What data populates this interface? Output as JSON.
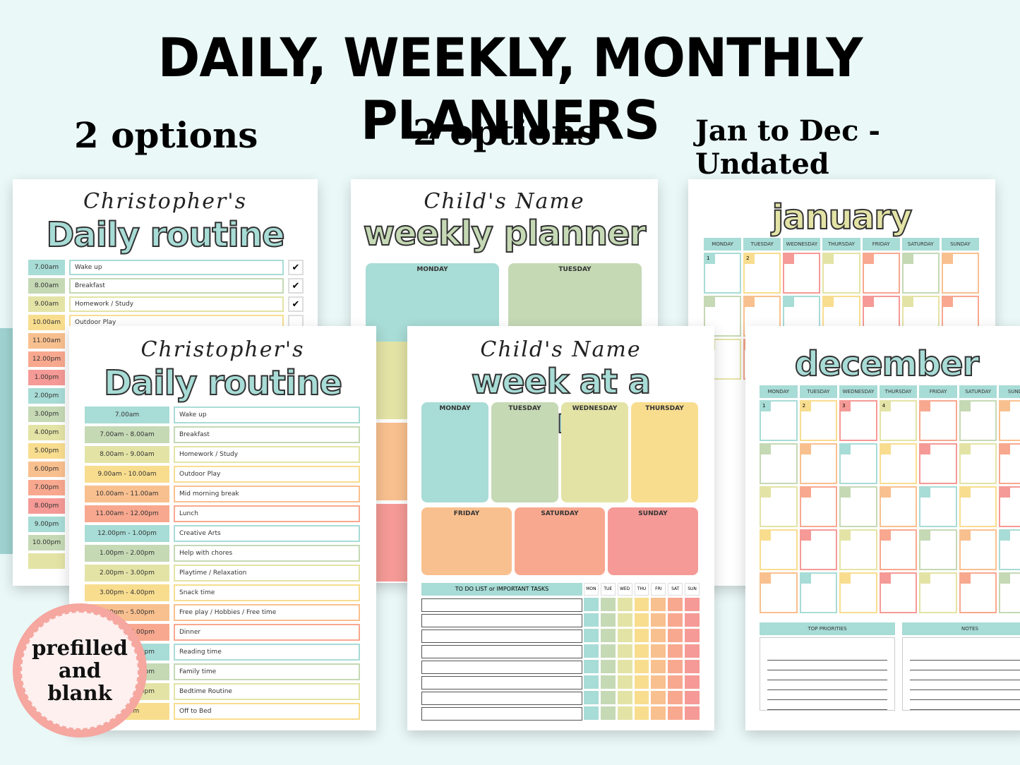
{
  "headline": "DAILY, WEEKLY, MONTHLY PLANNERS",
  "subheads": [
    "2 options",
    "2 options",
    "Jan to Dec - Undated"
  ],
  "colors": {
    "teal": "#a8dcd6",
    "green": "#c5d9b5",
    "lime": "#e3e3a6",
    "yellow": "#f8dd8f",
    "orange": "#f9c08f",
    "salmon": "#f8a88f",
    "pink": "#f59a96",
    "background": "#eaf8f8"
  },
  "daily_back": {
    "name": "Christopher's",
    "title": "Daily routine",
    "times": [
      "7.00am",
      "8.00am",
      "9.00am",
      "10.00am",
      "11.00am",
      "12.00pm",
      "1.00pm",
      "2.00pm",
      "3.00pm",
      "4.00pm",
      "5.00pm",
      "6.00pm",
      "7.00pm",
      "8.00pm",
      "9.00pm",
      "10.00pm",
      ""
    ],
    "activities": [
      "Wake up",
      "Breakfast",
      "Homework / Study",
      "Outdoor Play"
    ],
    "checks": [
      "✔",
      "✔",
      "✔",
      ""
    ]
  },
  "daily_front": {
    "name": "Christopher's",
    "title": "Daily routine",
    "times": [
      "7.00am",
      "7.00am - 8.00am",
      "8.00am - 9.00am",
      "9.00am - 10.00am",
      "10.00am - 11.00am",
      "11.00am - 12.00pm",
      "12.00pm - 1.00pm",
      "1.00pm - 2.00pm",
      "2.00pm - 3.00pm",
      "3.00pm - 4.00pm",
      "4.00pm - 5.00pm",
      "5.00pm - 6.00pm",
      "6.00pm - 7.00pm",
      "7.00pm - 8.00pm",
      "8.00pm - 9.00pm",
      "9.00pm"
    ],
    "activities": [
      "Wake up",
      "Breakfast",
      "Homework / Study",
      "Outdoor Play",
      "Mid morning break",
      "Lunch",
      "Creative Arts",
      "Help with chores",
      "Playtime / Relaxation",
      "Snack time",
      "Free play / Hobbies / Free time",
      "Dinner",
      "Reading time",
      "Family time",
      "Bedtime Routine",
      "Off to Bed"
    ]
  },
  "weekly": {
    "name": "Child's Name",
    "title": "weekly planner",
    "days": [
      "MONDAY",
      "TUESDAY"
    ]
  },
  "glance": {
    "name": "Child's Name",
    "title": "week at a glance",
    "top_days": [
      "MONDAY",
      "TUESDAY",
      "WEDNESDAY",
      "THURSDAY"
    ],
    "bottom_days": [
      "FRIDAY",
      "SATURDAY",
      "SUNDAY"
    ],
    "todo_label": "TO DO LIST or IMPORTANT TASKS",
    "short_days": [
      "MON",
      "TUE",
      "WED",
      "THU",
      "FRI",
      "SAT",
      "SUN"
    ]
  },
  "january": {
    "title": "january",
    "days": [
      "MONDAY",
      "TUESDAY",
      "WEDNESDAY",
      "THURSDAY",
      "FRIDAY",
      "SATURDAY",
      "SUNDAY"
    ],
    "dates": [
      "1",
      "2"
    ]
  },
  "december": {
    "title": "december",
    "days": [
      "MONDAY",
      "TUESDAY",
      "WEDNESDAY",
      "THURSDAY",
      "FRIDAY",
      "SATURDAY",
      "SUNDAY"
    ],
    "dates": [
      "1",
      "2",
      "3",
      "4"
    ],
    "priorities_label": "TOP PRIORITIES",
    "notes_label": "NOTES"
  },
  "badge": {
    "line1": "prefilled",
    "line2": "and",
    "line3": "blank"
  }
}
